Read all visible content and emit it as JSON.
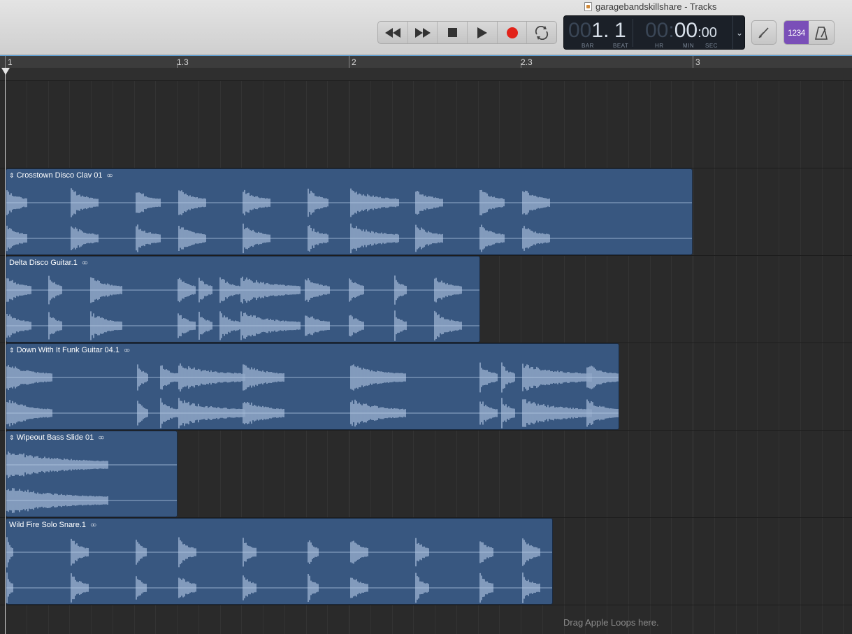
{
  "window": {
    "title": "garagebandskillshare - Tracks"
  },
  "transport": {
    "buttons": [
      "rewind",
      "fast-forward",
      "stop",
      "play",
      "record",
      "cycle"
    ]
  },
  "lcd": {
    "bar_dim": "00",
    "bar": "1",
    "beat": "1",
    "bar_label": "BAR",
    "beat_label": "BEAT",
    "hr_dim": "00:",
    "min": "00",
    "sec": ":00",
    "hr_label": "HR",
    "min_label": "MIN",
    "sec_label": "SEC"
  },
  "controls": {
    "count_in": "1234"
  },
  "ruler": {
    "labels": [
      "1",
      "1.3",
      "2",
      "2.3",
      "3"
    ]
  },
  "regions": [
    {
      "name": "Crosstown Disco Clav 01",
      "has_arrows": true,
      "end_bar": 2.96
    },
    {
      "name": "Delta Disco Guitar.1",
      "has_arrows": false,
      "end_bar": 2.38
    },
    {
      "name": "Down With It Funk Guitar 04.1",
      "has_arrows": true,
      "end_bar": 2.78
    },
    {
      "name": "Wipeout Bass Slide 01",
      "has_arrows": true,
      "end_bar": 1.5
    },
    {
      "name": "Wild Fire Solo Snare.1",
      "has_arrows": false,
      "end_bar": 2.59
    }
  ],
  "hint": "Drag Apple Loops here.",
  "colors": {
    "region": "#385780",
    "waveform": "#b4c8e4",
    "count_in_active": "#7a4fb8",
    "record": "#e2231a",
    "ruler_accent": "#5aa0d8"
  }
}
